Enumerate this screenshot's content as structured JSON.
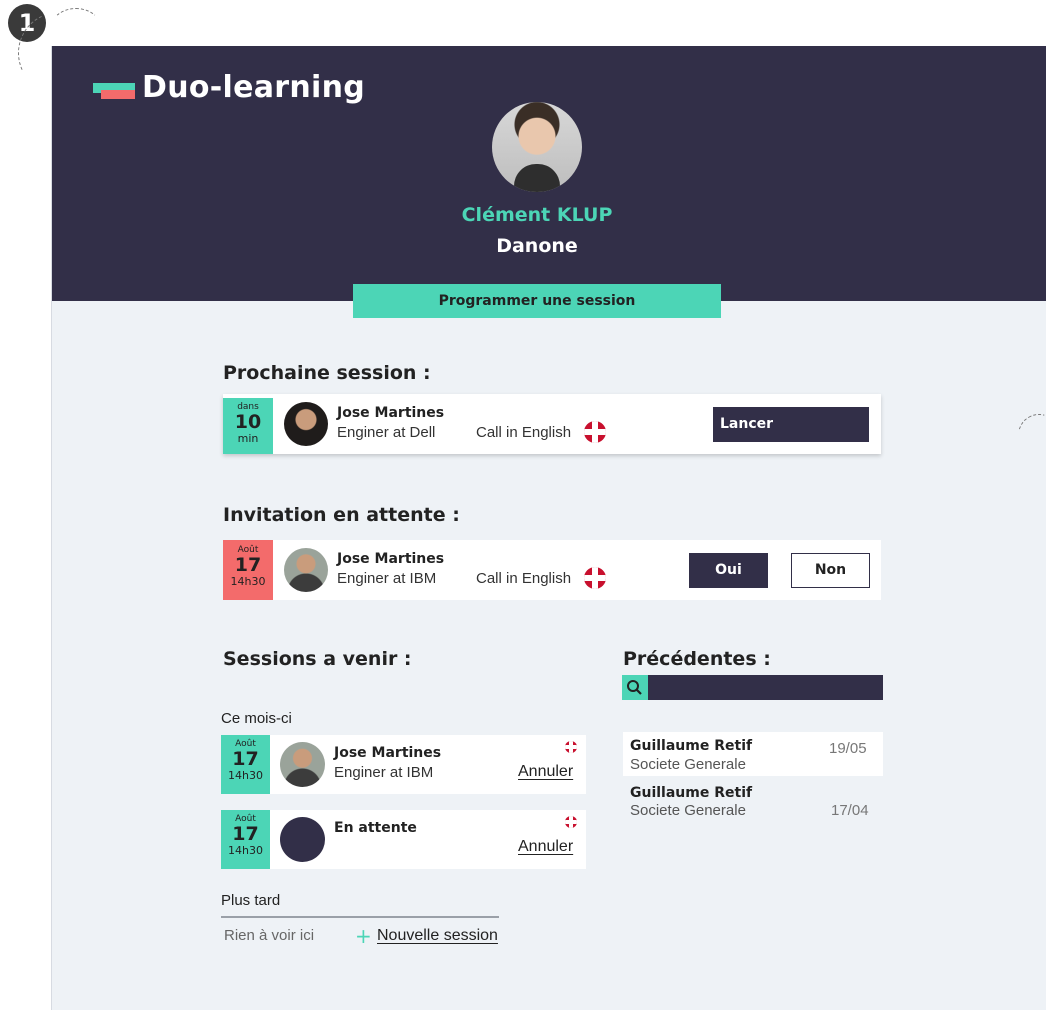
{
  "step": {
    "number": "1"
  },
  "app": {
    "title": "Duo-learning"
  },
  "profile": {
    "name": "Clément KLUP",
    "company": "Danone"
  },
  "schedule_button": "Programmer une session",
  "next_session": {
    "title": "Prochaine session :",
    "date": {
      "top": "dans",
      "mid": "10",
      "bot": "min"
    },
    "person": "Jose Martines",
    "role": "Enginer at Dell",
    "call": "Call in English",
    "action": "Lancer"
  },
  "pending": {
    "title": "Invitation en attente :",
    "date": {
      "top": "Août",
      "mid": "17",
      "bot": "14h30"
    },
    "person": "Jose Martines",
    "role": "Enginer at IBM",
    "call": "Call in English",
    "accept": "Oui",
    "decline": "Non"
  },
  "upcoming": {
    "title": "Sessions a venir :",
    "this_month": "Ce mois-ci",
    "items": [
      {
        "date": {
          "top": "Août",
          "mid": "17",
          "bot": "14h30"
        },
        "person": "Jose Martines",
        "role": "Enginer at IBM",
        "cancel": "Annuler"
      },
      {
        "date": {
          "top": "Août",
          "mid": "17",
          "bot": "14h30"
        },
        "person": "En attente",
        "role": "",
        "cancel": "Annuler"
      }
    ],
    "later": "Plus tard",
    "empty": "Rien à voir ici",
    "plus": "+",
    "new_session": "Nouvelle session"
  },
  "previous": {
    "title": "Précédentes :",
    "items": [
      {
        "person": "Guillaume Retif",
        "company": "Societe Generale",
        "date": "19/05"
      },
      {
        "person": "Guillaume Retif",
        "company": "Societe Generale",
        "date": "17/04"
      }
    ]
  },
  "colors": {
    "navy": "#322f48",
    "mint": "#4cd5b6",
    "coral": "#f36b6b",
    "background": "#eef2f6"
  }
}
